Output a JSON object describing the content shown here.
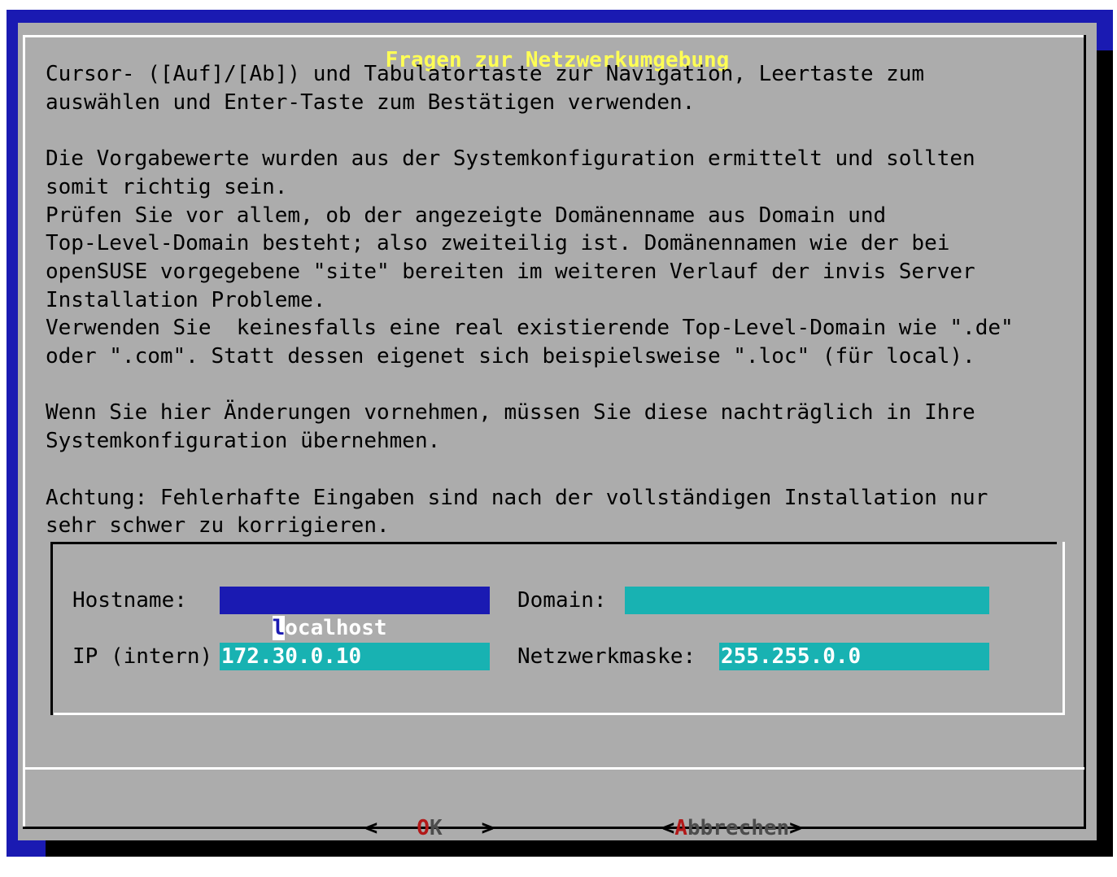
{
  "dialog": {
    "title": "Fragen zur Netzwerkumgebung",
    "message": "Cursor- ([Auf]/[Ab]) und Tabulatortaste zur Navigation, Leertaste zum\nauswählen und Enter-Taste zum Bestätigen verwenden.\n\nDie Vorgabewerte wurden aus der Systemkonfiguration ermittelt und sollten\nsomit richtig sein.\nPrüfen Sie vor allem, ob der angezeigte Domänenname aus Domain und\nTop-Level-Domain besteht; also zweiteilig ist. Domänennamen wie der bei\nopenSUSE vorgegebene \"site\" bereiten im weiteren Verlauf der invis Server\nInstallation Probleme.\nVerwenden Sie  keinesfalls eine real existierende Top-Level-Domain wie \".de\"\noder \".com\". Statt dessen eigenet sich beispielsweise \".loc\" (für local).\n\nWenn Sie hier Änderungen vornehmen, müssen Sie diese nachträglich in Ihre\nSystemkonfiguration übernehmen.\n\nAchtung: Fehlerhafte Eingaben sind nach der vollständigen Installation nur\nsehr schwer zu korrigieren."
  },
  "form": {
    "hostname_label": "Hostname:",
    "hostname_cursor_char": "l",
    "hostname_rest": "ocalhost",
    "domain_label": "Domain:",
    "domain_value": "",
    "ip_label": "IP (intern)",
    "ip_value": "172.30.0.10",
    "netmask_label": "Netzwerkmaske:",
    "netmask_value": "255.255.0.0"
  },
  "buttons": {
    "ok": {
      "open": "<",
      "hot": "O",
      "rest": "K",
      "close": ">"
    },
    "cancel": {
      "open": "<",
      "hot": "A",
      "rest": "bbrechen",
      "close": ">"
    }
  },
  "colors": {
    "screen_bg": "#1a1ab2",
    "dialog_bg": "#acacac",
    "title": "#ffff55",
    "input_bg": "#18b2b2",
    "focused_input_bg": "#1a1ab2",
    "hotkey": "#b21818"
  }
}
